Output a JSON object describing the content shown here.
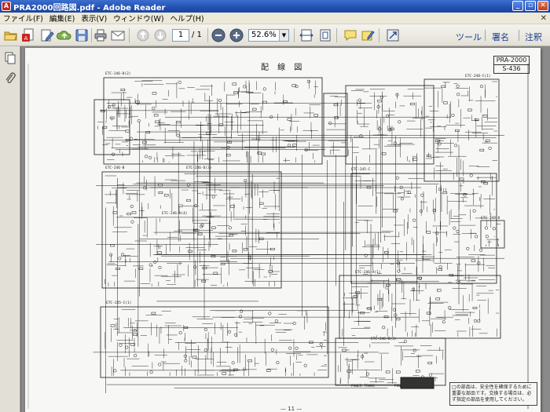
{
  "window": {
    "title": "PRA2000回路図.pdf - Adobe Reader",
    "buttons": {
      "minimize": "_",
      "restore": "▫",
      "close": "✕"
    }
  },
  "menu": {
    "items": [
      "ファイル(F)",
      "編集(E)",
      "表示(V)",
      "ウィンドウ(W)",
      "ヘルプ(H)"
    ],
    "close_glyph": "✕"
  },
  "toolbar": {
    "current_page": "1",
    "page_total": "/ 1",
    "zoom": "52.6%",
    "links": {
      "tools": "ツール",
      "sign": "署名",
      "comment": "注釈"
    }
  },
  "document": {
    "heading": "配 線 図",
    "model_lines": [
      "PRA-2000",
      "S-436"
    ],
    "page_number": "— 11 —",
    "notice": "□の部品は、安全性を確保するために重要な部品です。交換する場合は、必ず指定の部品を使用してください。",
    "board_labels": [
      "ETC-246-D(2)",
      "ETC-246-A(4)",
      "ETC-246-B",
      "ETC-245-C(1)",
      "ETC-245-C",
      "ETC-248-C(1)",
      "ETC-246-D(3)",
      "ETC-246-A(1)",
      "ETC-246-B(3)",
      "ETC-248-D",
      "POWER TRANS",
      "POWER SW"
    ]
  },
  "colors": {
    "titlebar": "#2450b0",
    "page": "#f7f7f5",
    "ink": "#1a1a1a",
    "link": "#1a3d8f"
  }
}
